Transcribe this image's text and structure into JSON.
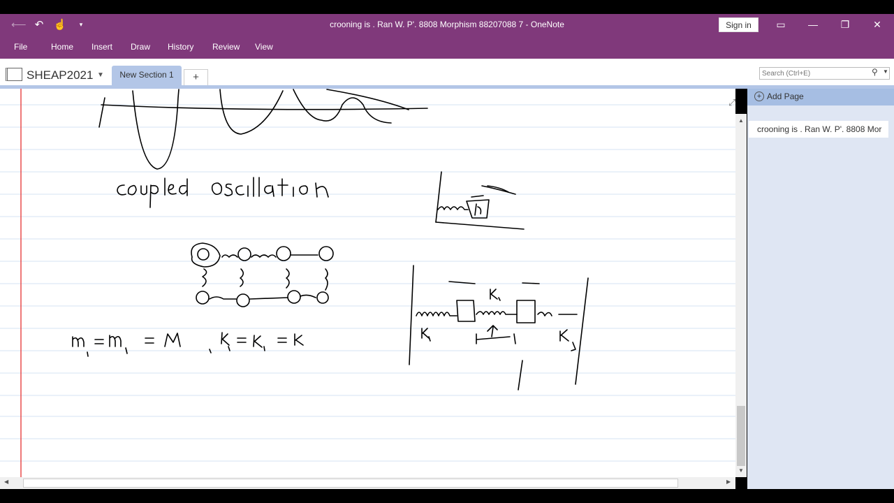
{
  "window": {
    "title": "crooning is . Ran W. P'. 8808  Morphism 88207088 7  -  OneNote",
    "signin_label": "Sign in"
  },
  "ribbon": {
    "tabs": [
      "File",
      "Home",
      "Insert",
      "Draw",
      "History",
      "Review",
      "View"
    ]
  },
  "notebook": {
    "name": "SHEAP2021",
    "section_tab": "New Section 1",
    "add_section": "+"
  },
  "search": {
    "placeholder": "Search (Ctrl+E)"
  },
  "pages": {
    "add_label": "Add Page",
    "items": [
      "crooning is . Ran W. P'. 8808  Mor"
    ]
  },
  "colors": {
    "onenote_purple": "#80397b",
    "section_tab": "#b3c6e7",
    "margin_line": "#e84b4b",
    "rule_line": "#d5e3f3"
  },
  "notes": {
    "heading": "coupled oscillation",
    "equation": "m₁ = m₂ = M   , k₁ = k_c = k",
    "labels": [
      "k₁",
      "k₁",
      "k₂",
      "M"
    ]
  }
}
